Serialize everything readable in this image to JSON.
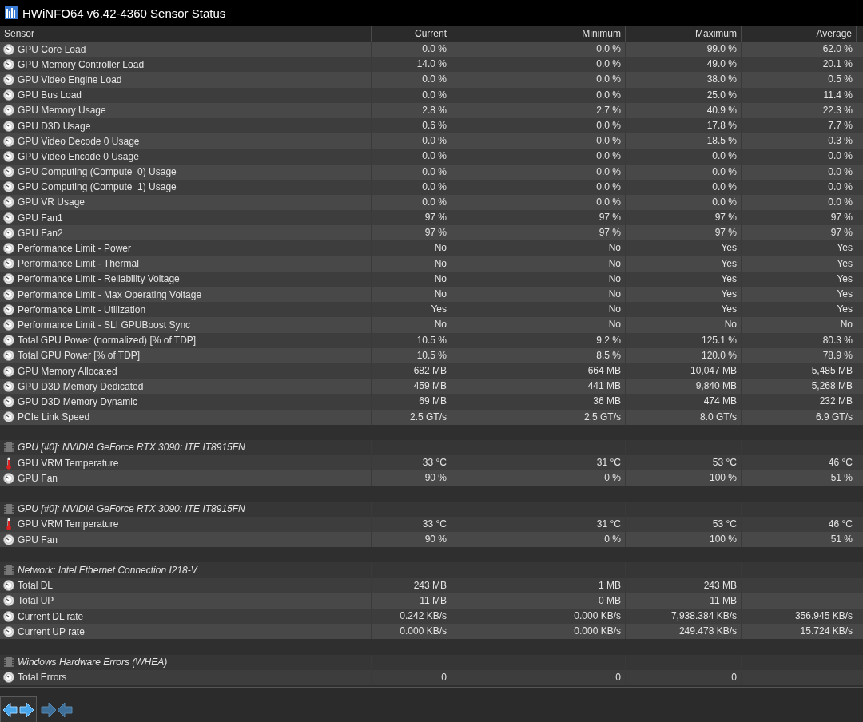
{
  "window": {
    "title": "HWiNFO64 v6.42-4360 Sensor Status"
  },
  "table": {
    "columns": [
      "Sensor",
      "Current",
      "Minimum",
      "Maximum",
      "Average"
    ],
    "rows": [
      {
        "kind": "gauge",
        "name": "GPU Core Load",
        "current": "0.0 %",
        "minimum": "0.0 %",
        "maximum": "99.0 %",
        "average": "62.0 %"
      },
      {
        "kind": "gauge",
        "name": "GPU Memory Controller Load",
        "current": "14.0 %",
        "minimum": "0.0 %",
        "maximum": "49.0 %",
        "average": "20.1 %"
      },
      {
        "kind": "gauge",
        "name": "GPU Video Engine Load",
        "current": "0.0 %",
        "minimum": "0.0 %",
        "maximum": "38.0 %",
        "average": "0.5 %"
      },
      {
        "kind": "gauge",
        "name": "GPU Bus Load",
        "current": "0.0 %",
        "minimum": "0.0 %",
        "maximum": "25.0 %",
        "average": "11.4 %"
      },
      {
        "kind": "gauge",
        "name": "GPU Memory Usage",
        "current": "2.8 %",
        "minimum": "2.7 %",
        "maximum": "40.9 %",
        "average": "22.3 %"
      },
      {
        "kind": "gauge",
        "name": "GPU D3D Usage",
        "current": "0.6 %",
        "minimum": "0.0 %",
        "maximum": "17.8 %",
        "average": "7.7 %"
      },
      {
        "kind": "gauge",
        "name": "GPU Video Decode 0 Usage",
        "current": "0.0 %",
        "minimum": "0.0 %",
        "maximum": "18.5 %",
        "average": "0.3 %"
      },
      {
        "kind": "gauge",
        "name": "GPU Video Encode 0 Usage",
        "current": "0.0 %",
        "minimum": "0.0 %",
        "maximum": "0.0 %",
        "average": "0.0 %"
      },
      {
        "kind": "gauge",
        "name": "GPU Computing (Compute_0) Usage",
        "current": "0.0 %",
        "minimum": "0.0 %",
        "maximum": "0.0 %",
        "average": "0.0 %"
      },
      {
        "kind": "gauge",
        "name": "GPU Computing (Compute_1) Usage",
        "current": "0.0 %",
        "minimum": "0.0 %",
        "maximum": "0.0 %",
        "average": "0.0 %"
      },
      {
        "kind": "gauge",
        "name": "GPU VR Usage",
        "current": "0.0 %",
        "minimum": "0.0 %",
        "maximum": "0.0 %",
        "average": "0.0 %"
      },
      {
        "kind": "gauge",
        "name": "GPU Fan1",
        "current": "97 %",
        "minimum": "97 %",
        "maximum": "97 %",
        "average": "97 %"
      },
      {
        "kind": "gauge",
        "name": "GPU Fan2",
        "current": "97 %",
        "minimum": "97 %",
        "maximum": "97 %",
        "average": "97 %"
      },
      {
        "kind": "gauge",
        "name": "Performance Limit - Power",
        "current": "No",
        "minimum": "No",
        "maximum": "Yes",
        "average": "Yes"
      },
      {
        "kind": "gauge",
        "name": "Performance Limit - Thermal",
        "current": "No",
        "minimum": "No",
        "maximum": "Yes",
        "average": "Yes"
      },
      {
        "kind": "gauge",
        "name": "Performance Limit - Reliability Voltage",
        "current": "No",
        "minimum": "No",
        "maximum": "Yes",
        "average": "Yes"
      },
      {
        "kind": "gauge",
        "name": "Performance Limit - Max Operating Voltage",
        "current": "No",
        "minimum": "No",
        "maximum": "Yes",
        "average": "Yes"
      },
      {
        "kind": "gauge",
        "name": "Performance Limit - Utilization",
        "current": "Yes",
        "minimum": "No",
        "maximum": "Yes",
        "average": "Yes"
      },
      {
        "kind": "gauge",
        "name": "Performance Limit - SLI GPUBoost Sync",
        "current": "No",
        "minimum": "No",
        "maximum": "No",
        "average": "No"
      },
      {
        "kind": "gauge",
        "name": "Total GPU Power (normalized) [% of TDP]",
        "current": "10.5 %",
        "minimum": "9.2 %",
        "maximum": "125.1 %",
        "average": "80.3 %"
      },
      {
        "kind": "gauge",
        "name": "Total GPU Power [% of TDP]",
        "current": "10.5 %",
        "minimum": "8.5 %",
        "maximum": "120.0 %",
        "average": "78.9 %"
      },
      {
        "kind": "gauge",
        "name": "GPU Memory Allocated",
        "current": "682 MB",
        "minimum": "664 MB",
        "maximum": "10,047 MB",
        "average": "5,485 MB"
      },
      {
        "kind": "gauge",
        "name": "GPU D3D Memory Dedicated",
        "current": "459 MB",
        "minimum": "441 MB",
        "maximum": "9,840 MB",
        "average": "5,268 MB"
      },
      {
        "kind": "gauge",
        "name": "GPU D3D Memory Dynamic",
        "current": "69 MB",
        "minimum": "36 MB",
        "maximum": "474 MB",
        "average": "232 MB"
      },
      {
        "kind": "gauge",
        "name": "PCIe Link Speed",
        "current": "2.5 GT/s",
        "minimum": "2.5 GT/s",
        "maximum": "8.0 GT/s",
        "average": "6.9 GT/s"
      },
      {
        "kind": "group",
        "name": "GPU [#0]: NVIDIA GeForce RTX 3090: ITE IT8915FN"
      },
      {
        "kind": "temperature",
        "name": "GPU VRM Temperature",
        "current": "33 °C",
        "minimum": "31 °C",
        "maximum": "53 °C",
        "average": "46 °C"
      },
      {
        "kind": "gauge",
        "name": "GPU Fan",
        "current": "90 %",
        "minimum": "0 %",
        "maximum": "100 %",
        "average": "51 %"
      },
      {
        "kind": "group",
        "name": "GPU [#0]: NVIDIA GeForce RTX 3090: ITE IT8915FN"
      },
      {
        "kind": "temperature",
        "name": "GPU VRM Temperature",
        "current": "33 °C",
        "minimum": "31 °C",
        "maximum": "53 °C",
        "average": "46 °C"
      },
      {
        "kind": "gauge",
        "name": "GPU Fan",
        "current": "90 %",
        "minimum": "0 %",
        "maximum": "100 %",
        "average": "51 %"
      },
      {
        "kind": "group",
        "name": "Network: Intel Ethernet Connection I218-V"
      },
      {
        "kind": "gauge",
        "name": "Total DL",
        "current": "243 MB",
        "minimum": "1 MB",
        "maximum": "243 MB"
      },
      {
        "kind": "gauge",
        "name": "Total UP",
        "current": "11 MB",
        "minimum": "0 MB",
        "maximum": "11 MB"
      },
      {
        "kind": "gauge",
        "name": "Current DL rate",
        "current": "0.242 KB/s",
        "minimum": "0.000 KB/s",
        "maximum": "7,938.384 KB/s",
        "average": "356.945 KB/s"
      },
      {
        "kind": "gauge",
        "name": "Current UP rate",
        "current": "0.000 KB/s",
        "minimum": "0.000 KB/s",
        "maximum": "249.478 KB/s",
        "average": "15.724 KB/s"
      },
      {
        "kind": "group",
        "name": "Windows Hardware Errors (WHEA)"
      },
      {
        "kind": "gauge",
        "name": "Total Errors",
        "current": "0",
        "minimum": "0",
        "maximum": "0"
      }
    ]
  },
  "toolbar": {
    "buttons": [
      {
        "kind": "expand",
        "selected": true
      },
      {
        "kind": "collapse",
        "selected": false
      }
    ]
  }
}
